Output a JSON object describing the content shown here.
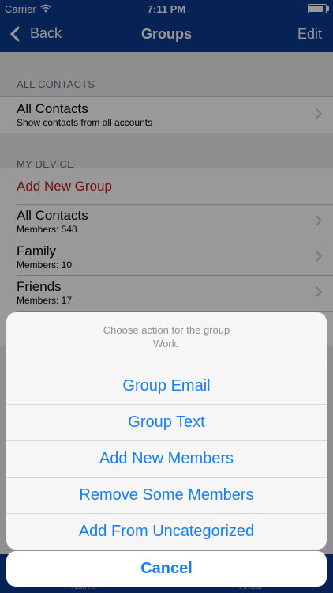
{
  "status_bar": {
    "carrier": "Carrier",
    "time": "7:11 PM"
  },
  "nav": {
    "back_label": "Back",
    "title": "Groups",
    "edit_label": "Edit"
  },
  "sections": {
    "all_contacts": {
      "header": "ALL CONTACTS",
      "item": {
        "title": "All Contacts",
        "subtitle": "Show contacts from all accounts"
      }
    },
    "my_device": {
      "header": "MY DEVICE",
      "add_new_group": "Add New Group",
      "groups": [
        {
          "title": "All Contacts",
          "subtitle": "Members: 548"
        },
        {
          "title": "Family",
          "subtitle": "Members: 10"
        },
        {
          "title": "Friends",
          "subtitle": "Members: 17"
        }
      ]
    }
  },
  "tabbar": {
    "tabs": [
      "Native",
      "Virtual"
    ]
  },
  "action_sheet": {
    "message_line1": "Choose action for the group",
    "message_line2": "Work.",
    "buttons": [
      "Group Email",
      "Group Text",
      "Add New Members",
      "Remove Some Members",
      "Add From Uncategorized"
    ],
    "cancel_label": "Cancel"
  },
  "colors": {
    "nav_bar": "#0c3a8c",
    "action_blue": "#1a7ef0",
    "destructive_red": "#c3171a"
  }
}
